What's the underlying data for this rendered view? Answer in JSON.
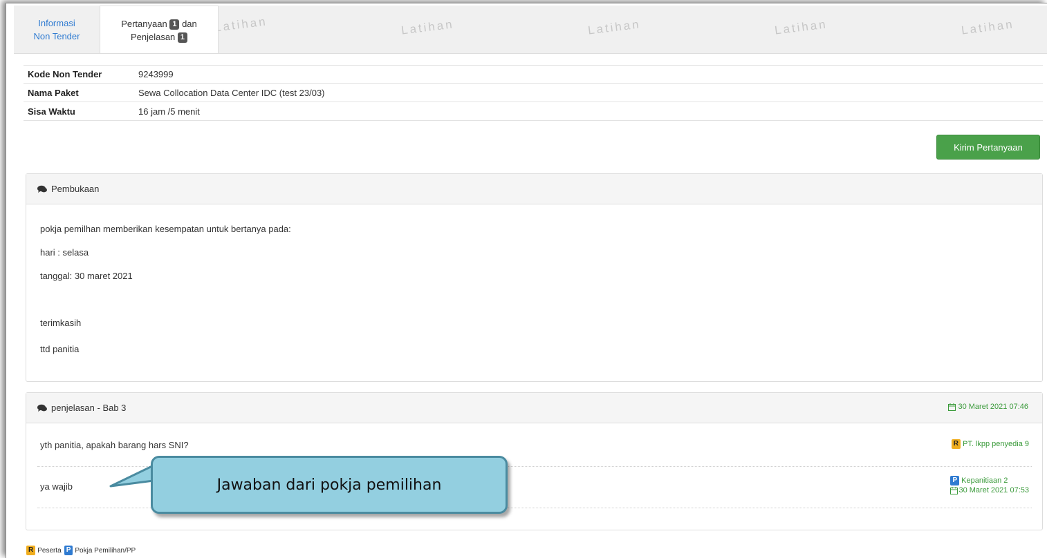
{
  "tabs": {
    "info_line1": "Informasi",
    "info_line2": "Non Tender",
    "qa_part1": "Pertanyaan",
    "qa_badge1": "1",
    "qa_part2": "dan",
    "qa_part3": "Penjelasan",
    "qa_badge2": "1"
  },
  "watermark_text": "Latihan",
  "info": {
    "rows": [
      {
        "label": "Kode Non Tender",
        "value": "9243999"
      },
      {
        "label": "Nama Paket",
        "value": "Sewa Collocation Data Center IDC (test 23/03)"
      },
      {
        "label": "Sisa Waktu",
        "value": "16 jam /5 menit"
      }
    ]
  },
  "send_button": "Kirim Pertanyaan",
  "pembukaan": {
    "title": "Pembukaan",
    "lines": [
      "pokja pemilhan memberikan kesempatan untuk bertanya pada:",
      "hari : selasa",
      "tanggal: 30 maret 2021",
      "terimkasih",
      "ttd panitia"
    ]
  },
  "penjelasan": {
    "title": "penjelasan - Bab 3",
    "date": "30 Maret 2021 07:46",
    "question": {
      "text": "yth panitia, apakah barang hars SNI?",
      "badge": "R",
      "author": "PT. lkpp penyedia 9"
    },
    "answer": {
      "text": "ya wajib",
      "badge": "P",
      "author": "Kepanitiaan 2",
      "date": "30 Maret 2021 07:53"
    }
  },
  "legend": {
    "r_badge": "R",
    "r_label": "Peserta",
    "p_badge": "P",
    "p_label": "Pokja Pemilihan/PP"
  },
  "callout": "Jawaban dari pokja pemilihan",
  "colors": {
    "accent_green": "#4aa14a",
    "link_blue": "#2f7bd1",
    "badge_orange": "#f0ad1e",
    "callout_fill": "#93cfe0"
  }
}
